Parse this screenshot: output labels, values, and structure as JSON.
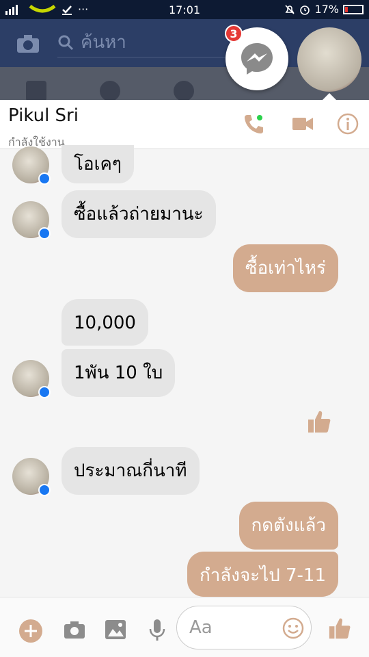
{
  "status_bar": {
    "time": "17:01",
    "battery": "17%",
    "battery_level": 0.17
  },
  "fb_header": {
    "search_placeholder": "ค้นหา"
  },
  "chat_head": {
    "badge_count": "3"
  },
  "conversation": {
    "contact_name": "Pikul  Sri",
    "contact_status": "กำลังใช้งาน"
  },
  "messages": [
    {
      "side": "in",
      "text": "โอเคๆ"
    },
    {
      "side": "in",
      "text": "ซื้อแล้วถ่ายมานะ"
    },
    {
      "side": "out",
      "text": "ซื้อเท่าไหร่"
    },
    {
      "side": "in",
      "text": "10,000"
    },
    {
      "side": "in",
      "text": "1พัน  10  ใบ"
    },
    {
      "side": "out",
      "type": "like"
    },
    {
      "side": "in",
      "text": "ประมาณกี่นาที"
    },
    {
      "side": "out",
      "text": "กดตังแล้ว"
    },
    {
      "side": "out",
      "text": "กำลังจะไป  7-11"
    }
  ],
  "composer": {
    "placeholder": "Aa"
  },
  "colors": {
    "accent": "#d3ab8f",
    "incoming_bubble": "#e5e5e5",
    "header_dark": "#2c3e66",
    "badge": "#e53935",
    "online": "#2bd14b"
  }
}
